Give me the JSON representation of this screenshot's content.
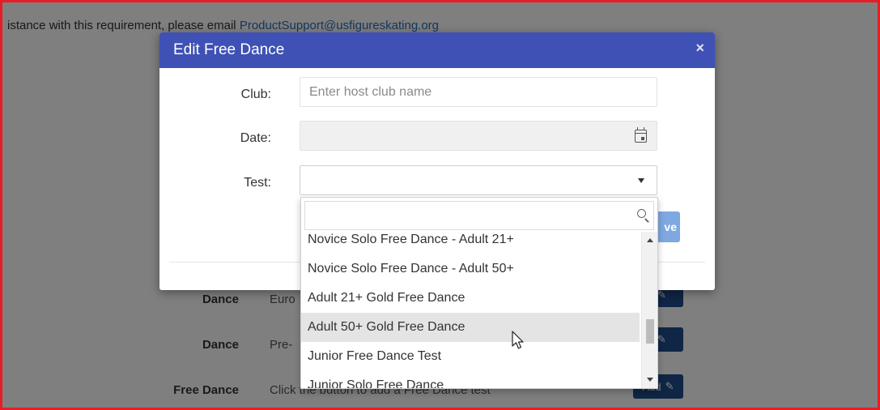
{
  "background": {
    "intro_text": "istance with this requirement, please email",
    "support_email": "ProductSupport@usfigureskating.org",
    "rows": [
      {
        "label": "Dance",
        "desc": "Euro"
      },
      {
        "label": "Dance",
        "desc": "Pre-"
      },
      {
        "label": "Free Dance",
        "desc": "Click the button to add a Free Dance test"
      }
    ],
    "button_labels": [
      "t",
      "t",
      "Add"
    ]
  },
  "modal": {
    "title": "Edit Free Dance",
    "close_symbol": "×",
    "club_label": "Club:",
    "club_placeholder": "Enter host club name",
    "date_label": "Date:",
    "test_label": "Test:",
    "test_value": "",
    "save_partial_label": "ve"
  },
  "dropdown": {
    "search_value": "",
    "options": [
      "Novice Solo Free Dance - Adult 21+",
      "Novice Solo Free Dance - Adult 50+",
      "Adult 21+ Gold Free Dance",
      "Adult 50+ Gold Free Dance",
      "Junior Free Dance Test",
      "Junior Solo Free Dance"
    ],
    "hovered_option": "Adult 50+ Gold Free Dance"
  },
  "colors": {
    "frame_border": "#e81c24",
    "modal_header": "#3f51b5",
    "page_button": "#1e4d8c",
    "save_button": "#7ea8e0"
  },
  "icons": [
    "close-icon",
    "calendar-icon",
    "caret-down-icon",
    "search-icon",
    "pencil-icon",
    "scroll-up-icon",
    "scroll-down-icon",
    "mouse-pointer-icon"
  ]
}
